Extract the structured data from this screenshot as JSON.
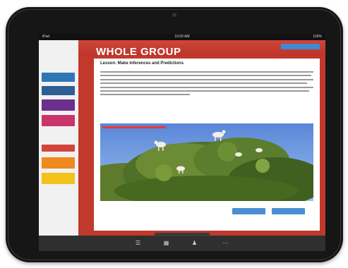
{
  "status_bar": {
    "left": "iPad",
    "center": "10:00 AM",
    "right": "100%"
  },
  "sidebar": {
    "logo": "",
    "items": [
      {
        "label": "",
        "color": "#2f76b7"
      },
      {
        "label": "",
        "color": "#2d5f95"
      },
      {
        "label": "",
        "color": "#6b2f8c"
      },
      {
        "label": "",
        "color": "#c8356b"
      },
      {
        "label": "",
        "color": "#d1453a"
      },
      {
        "label": "",
        "color": "#ee8a1e"
      },
      {
        "label": "",
        "color": "#f2c21b"
      }
    ]
  },
  "header": {
    "title": "WHOLE GROUP",
    "button_label": ""
  },
  "content": {
    "title": "Lesson: Make Inferences and Predictions",
    "body": "",
    "image_caption": "",
    "buttons": [
      "",
      ""
    ]
  },
  "bottom_bar": {
    "left_label": "",
    "right_label": ""
  },
  "colors": {
    "accent": "#c0392b",
    "button_blue": "#4a8fd3",
    "bezel": "#161616"
  }
}
